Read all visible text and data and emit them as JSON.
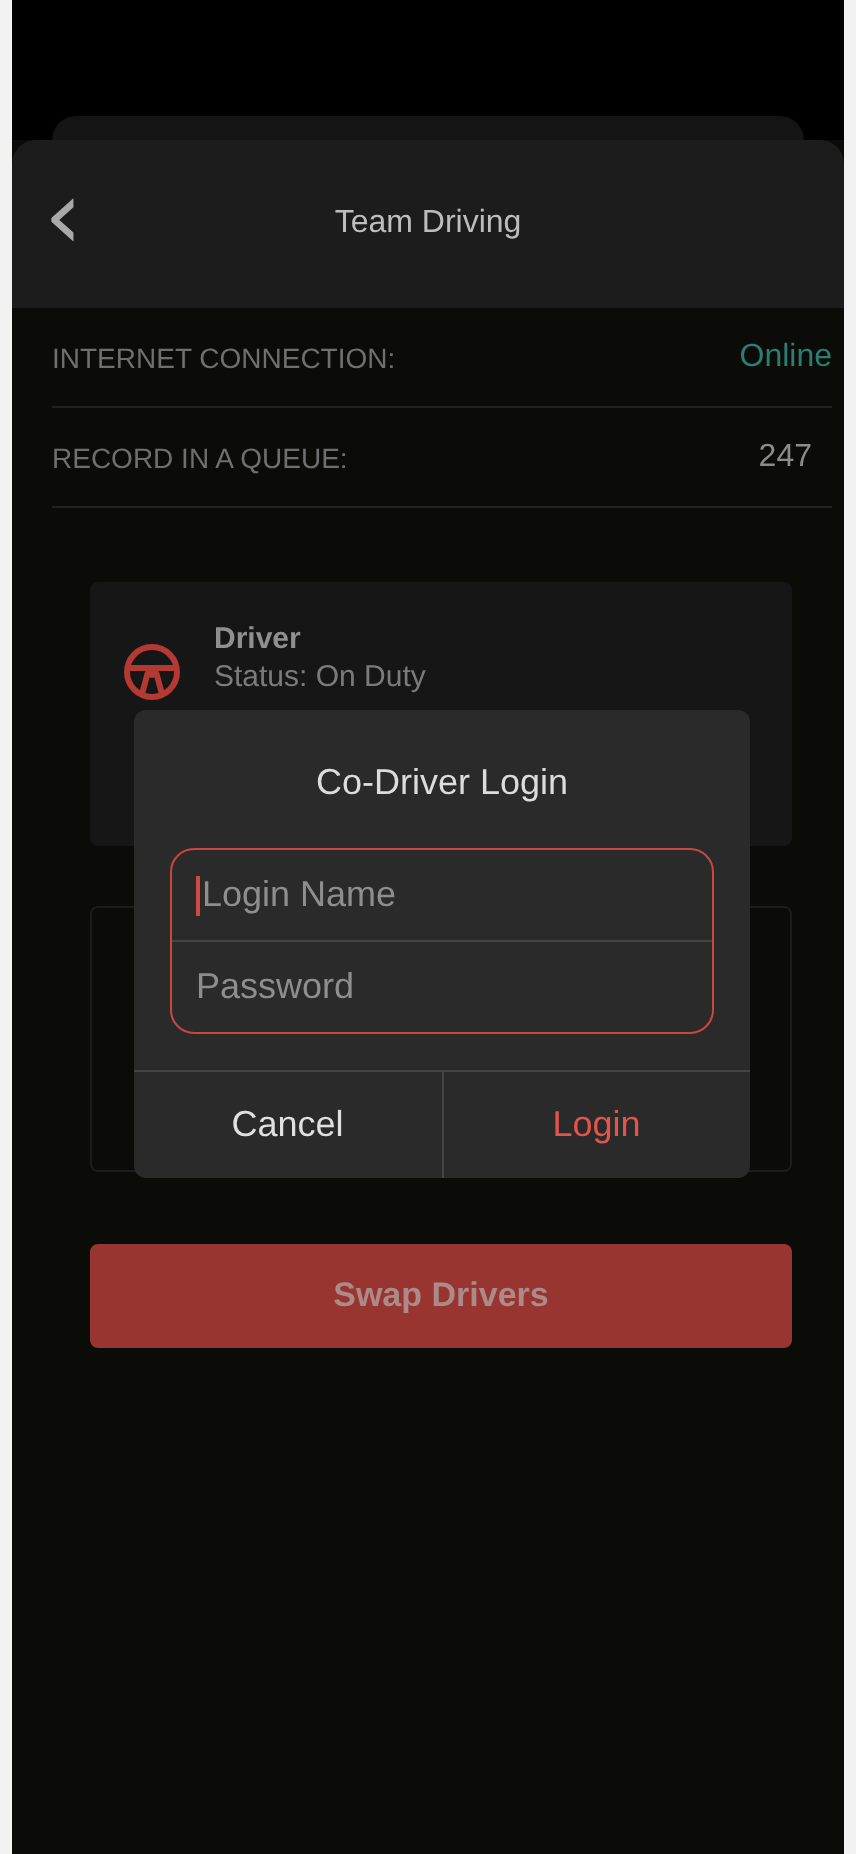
{
  "header": {
    "back_icon": "‹",
    "title": "Team Driving"
  },
  "info_rows": [
    {
      "label": "INTERNET CONNECTION:",
      "value": "Online",
      "kind": "status"
    },
    {
      "label": "RECORD IN A QUEUE:",
      "value": "247",
      "kind": "count"
    }
  ],
  "driver_card": {
    "role": "Driver",
    "status": "Status: On Duty"
  },
  "dialog": {
    "title": "Co-Driver Login",
    "fields": [
      {
        "placeholder": "Login Name",
        "focused": true
      },
      {
        "placeholder": "Password",
        "focused": false
      }
    ],
    "buttons": [
      {
        "label": "Cancel",
        "kind": "secondary"
      },
      {
        "label": "Login",
        "kind": "primary"
      }
    ]
  },
  "swap_button": "Swap Drivers"
}
